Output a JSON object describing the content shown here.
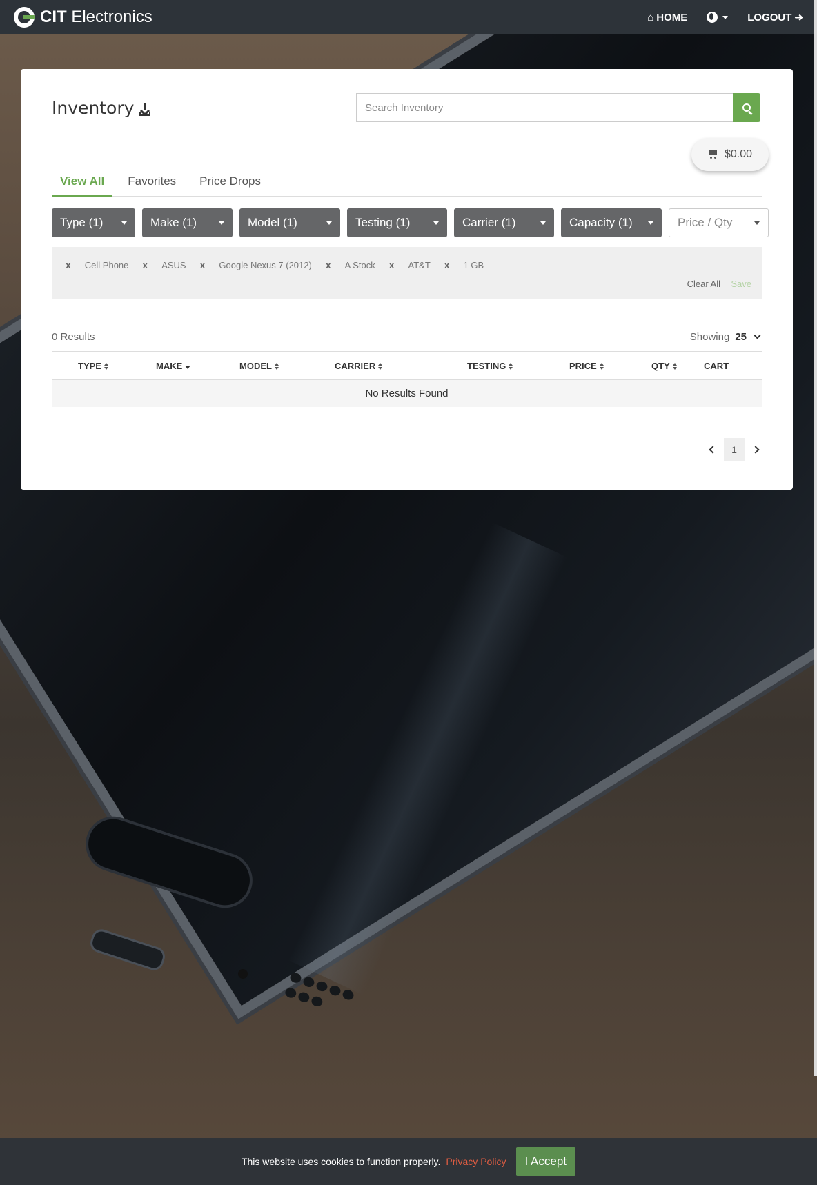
{
  "nav": {
    "brand_bold": "CIT",
    "brand_rest": " Electronics",
    "home_label": "HOME",
    "logout_label": "LOGOUT"
  },
  "inventory": {
    "title": "Inventory",
    "search_placeholder": "Search Inventory",
    "cart_total": "$0.00",
    "tabs": [
      "View All",
      "Favorites",
      "Price Drops"
    ],
    "active_tab": "View All",
    "filters": [
      "Type (1)",
      "Make (1)",
      "Model (1)",
      "Testing (1)",
      "Carrier (1)",
      "Capacity (1)",
      "Price / Qty"
    ],
    "chips": [
      "Cell Phone",
      "ASUS",
      "Google Nexus 7 (2012)",
      "A Stock",
      "AT&T",
      "1 GB"
    ],
    "chip_remove": "x",
    "clear_all": "Clear All",
    "save": "Save",
    "results_count": "0 Results",
    "showing_label": "Showing",
    "showing_value": "25",
    "columns": [
      "TYPE",
      "MAKE",
      "MODEL",
      "CARRIER",
      "TESTING",
      "PRICE",
      "QTY",
      "CART"
    ],
    "no_results": "No Results Found",
    "page": "1"
  },
  "cookie": {
    "message": "This website uses cookies to function properly.",
    "policy_link": "Privacy Policy",
    "accept": "I Accept"
  },
  "colors": {
    "accent": "#6aa84f",
    "navbar": "#2d3339",
    "filter_button": "#656668",
    "link_red": "#e05d42"
  }
}
